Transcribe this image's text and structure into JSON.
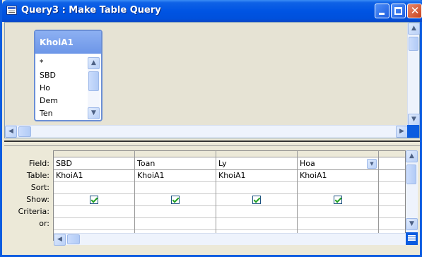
{
  "window": {
    "title": "Query3 : Make Table Query"
  },
  "controls": {
    "minimize": "minimize",
    "maximize": "maximize",
    "close_glyph": "✕"
  },
  "table": {
    "name": "KhoiA1",
    "fields": [
      "*",
      "SBD",
      "Ho",
      "Dem",
      "Ten"
    ]
  },
  "grid": {
    "row_labels": [
      "Field:",
      "Table:",
      "Sort:",
      "Show:",
      "Criteria:",
      "or:"
    ],
    "columns": [
      {
        "field": "SBD",
        "table": "KhoiA1",
        "sort": "",
        "show": true,
        "criteria": "",
        "or": ""
      },
      {
        "field": "Toan",
        "table": "KhoiA1",
        "sort": "",
        "show": true,
        "criteria": "",
        "or": ""
      },
      {
        "field": "Ly",
        "table": "KhoiA1",
        "sort": "",
        "show": true,
        "criteria": "",
        "or": ""
      },
      {
        "field": "Hoa",
        "table": "KhoiA1",
        "sort": "",
        "show": true,
        "criteria": "",
        "or": ""
      },
      {
        "field": "",
        "table": "",
        "sort": "",
        "show": false,
        "criteria": "",
        "or": ""
      }
    ]
  },
  "icons": {
    "title": "query-window-icon",
    "scroll_up": "▲",
    "scroll_down": "▼",
    "scroll_left": "◀",
    "scroll_right": "▶",
    "dropdown": "▼"
  },
  "colors": {
    "titlebar": "#0054E3",
    "workspace": "#ECE9D8",
    "table_header": "#7DA2EE",
    "checkmark": "#21A121"
  }
}
